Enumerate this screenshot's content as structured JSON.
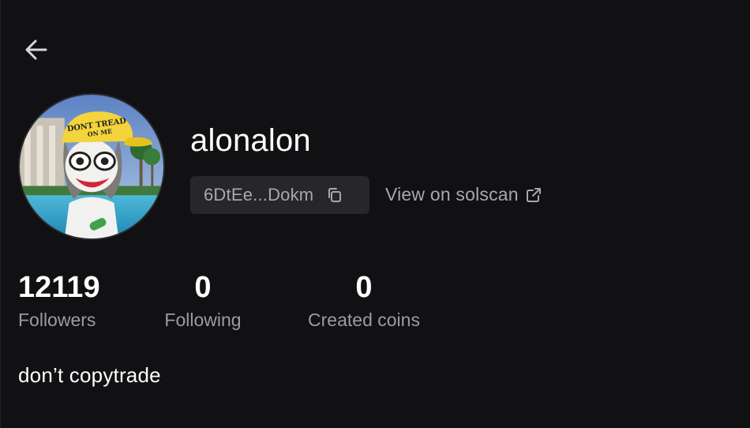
{
  "profile": {
    "username": "alonalon",
    "address_short": "6DtEe...Dokm",
    "solscan_label": "View on solscan",
    "bio": "don’t copytrade",
    "avatar_text": "DONT TREAD ON ME"
  },
  "stats": {
    "followers": {
      "value": "12119",
      "label": "Followers"
    },
    "following": {
      "value": "0",
      "label": "Following"
    },
    "created": {
      "value": "0",
      "label": "Created coins"
    }
  },
  "icons": {
    "back": "arrow-left-icon",
    "copy": "copy-icon",
    "external": "external-link-icon"
  },
  "colors": {
    "background": "#111113",
    "chip": "#26262b",
    "muted_text": "#a7a7ad",
    "text": "#ffffff"
  }
}
